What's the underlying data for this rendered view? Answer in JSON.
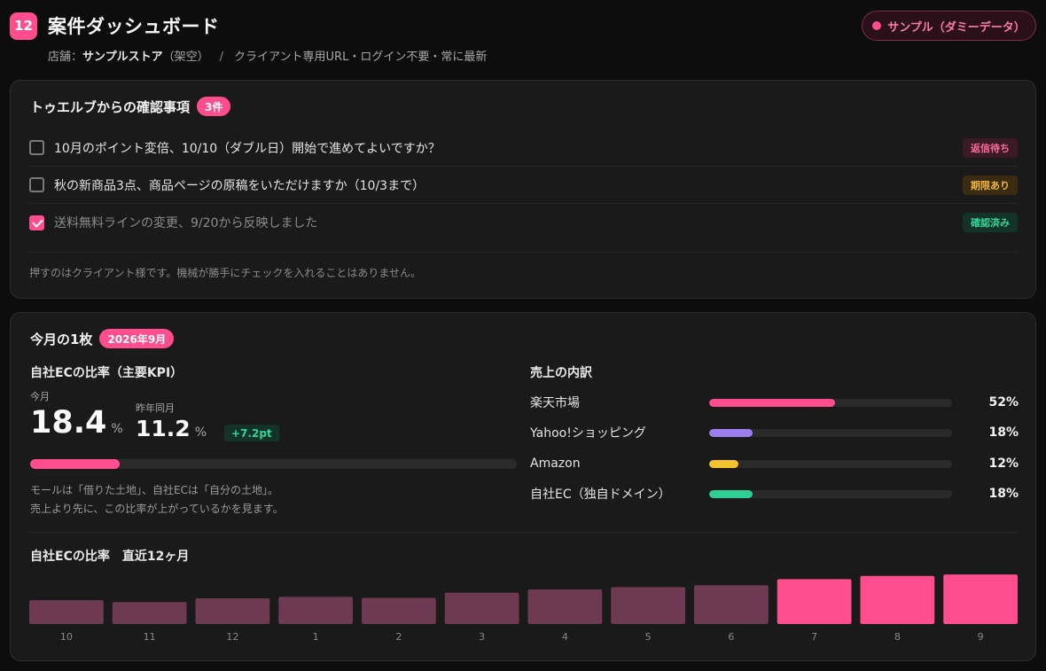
{
  "header": {
    "badge": "12",
    "title": "案件ダッシュボード",
    "store_prefix": "店舗：",
    "store_name": "サンプルストア",
    "store_note": "（架空）",
    "separator": "/",
    "meta": "クライアント専用URL・ログイン不要・常に最新",
    "sample_button": "サンプル（ダミーデータ）"
  },
  "confirm": {
    "title": "トゥエルブからの確認事項",
    "count": "3件",
    "items": [
      {
        "text": "10月のポイント変倍、10/10（ダブル日）開始で進めてよいですか？",
        "status": "返信待ち",
        "checked": false
      },
      {
        "text": "秋の新商品3点、商品ページの原稿をいただけますか（10/3まで）",
        "status": "期限あり",
        "checked": false
      },
      {
        "text": "送料無料ラインの変更、9/20から反映しました",
        "status": "確認済み",
        "checked": true
      }
    ],
    "note": "押すのはクライアント様です。機械が勝手にチェックを入れることはありません。"
  },
  "monthly": {
    "title": "今月の1枚",
    "month": "2026年9月",
    "kpi": {
      "label": "自社ECの比率（主要KPI）",
      "current_label": "今月",
      "current_value": "18.4",
      "unit": "%",
      "prev_label": "昨年同月",
      "prev_value": "11.2",
      "delta": "+7.2pt",
      "progress": 0.184,
      "note_line1": "モールは「借りた土地」、自社ECは「自分の土地」。",
      "note_line2": "売上より先に、この比率が上がっているかを見ます。"
    },
    "breakdown": {
      "label": "売上の内訳",
      "items": [
        {
          "name": "楽天市場",
          "pct": "52%",
          "value": 52,
          "color": "#ff4d8d"
        },
        {
          "name": "Yahoo!ショッピング",
          "pct": "18%",
          "value": 18,
          "color": "#9b7ff0"
        },
        {
          "name": "Amazon",
          "pct": "12%",
          "value": 12,
          "color": "#f5c22e"
        },
        {
          "name": "自社EC（独自ドメイン）",
          "pct": "18%",
          "value": 18,
          "color": "#2ecf94"
        }
      ]
    }
  },
  "chart_data": {
    "type": "bar",
    "title": "自社ECの比率　直近12ヶ月",
    "categories": [
      "10",
      "11",
      "12",
      "1",
      "2",
      "3",
      "4",
      "5",
      "6",
      "7",
      "8",
      "9"
    ],
    "values": [
      10.2,
      9.4,
      11.0,
      11.6,
      11.2,
      13.4,
      14.8,
      15.8,
      16.6,
      19.2,
      20.6,
      21.2
    ],
    "highlight_from_index": 9,
    "colors": {
      "base": "#6e3a52",
      "highlight": "#ff4d8d"
    },
    "ylim": [
      0,
      22
    ]
  }
}
